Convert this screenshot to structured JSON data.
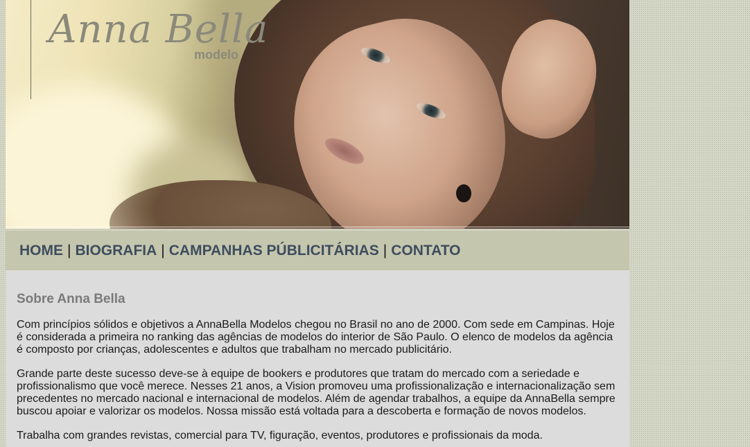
{
  "banner": {
    "logo_name": "Anna Bella",
    "logo_subtitle": "modelo",
    "photo": "model-portrait-photo"
  },
  "nav": {
    "home": "HOME",
    "biografia": "BIOGRAFIA",
    "campanhas": "CAMPANHAS PÚBLICITÁRIAS",
    "contato": "CONTATO",
    "separator": "|"
  },
  "content": {
    "title": "Sobre Anna Bella",
    "paragraphs": [
      "Com princípios sólidos e objetivos a AnnaBella Modelos chegou no Brasil no ano de 2000. Com sede em Campinas. Hoje é considerada a primeira no ranking das agências de modelos do interior de São Paulo. O elenco de modelos da agência é composto por crianças, adolescentes e adultos que trabalham no mercado publicitário.",
      "Grande parte deste sucesso deve-se à equipe de bookers e produtores que tratam do mercado com a seriedade e profissionalismo que você merece. Nesses 21 anos, a Vision promoveu uma profissionalização e internacionalização sem precedentes no mercado nacional e internacional de modelos. Além de agendar trabalhos, a equipe da AnnaBella sempre buscou apoiar e valorizar os modelos. Nossa missão está voltada para a descoberta e formação de novos modelos.",
      "Trabalha com grandes revistas, comercial para TV, figuração, eventos, produtores e profissionais da moda."
    ]
  },
  "colors": {
    "page_background": "#d4d6c6",
    "nav_background": "#c5c6ae",
    "nav_link": "#3e4d5e",
    "content_background": "#dcdcdc",
    "title": "#7a7a7a",
    "logo": "#8b897a"
  }
}
